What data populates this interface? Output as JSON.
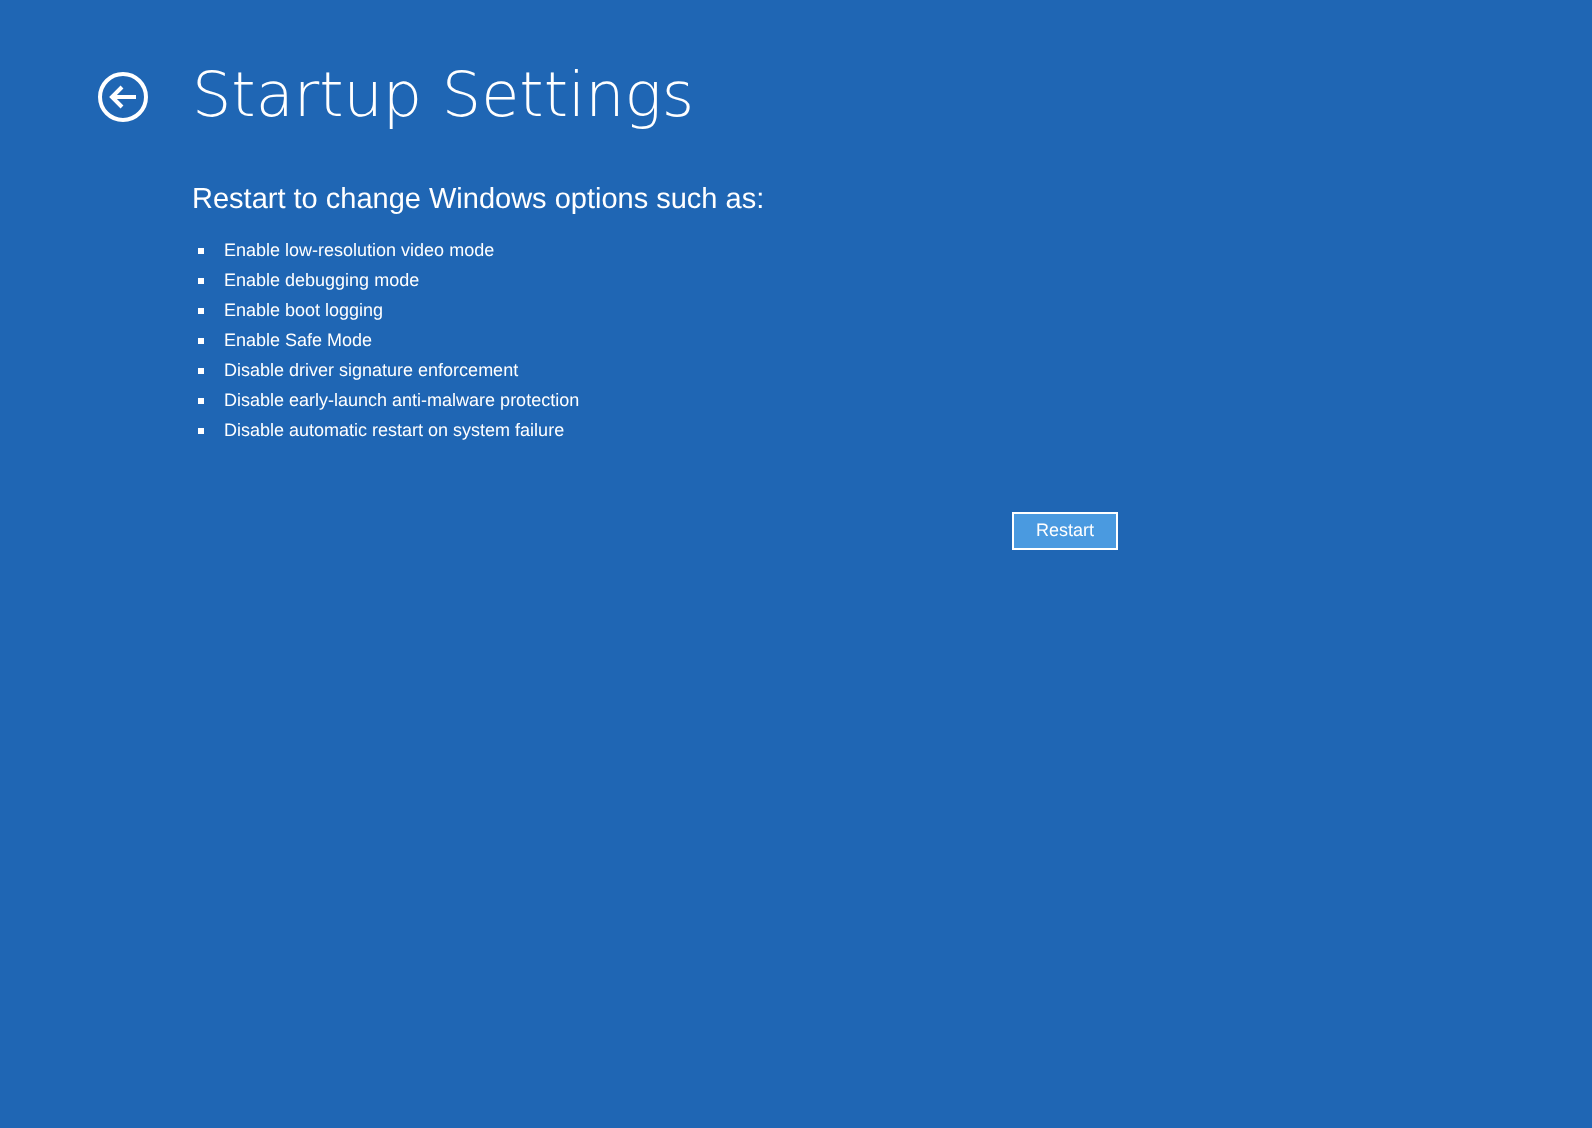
{
  "header": {
    "title": "Startup Settings"
  },
  "intro": "Restart to change Windows options such as:",
  "options": [
    "Enable low-resolution video mode",
    "Enable debugging mode",
    "Enable boot logging",
    "Enable Safe Mode",
    "Disable driver signature enforcement",
    "Disable early-launch anti-malware protection",
    "Disable automatic restart on system failure"
  ],
  "button": {
    "label": "Restart"
  }
}
